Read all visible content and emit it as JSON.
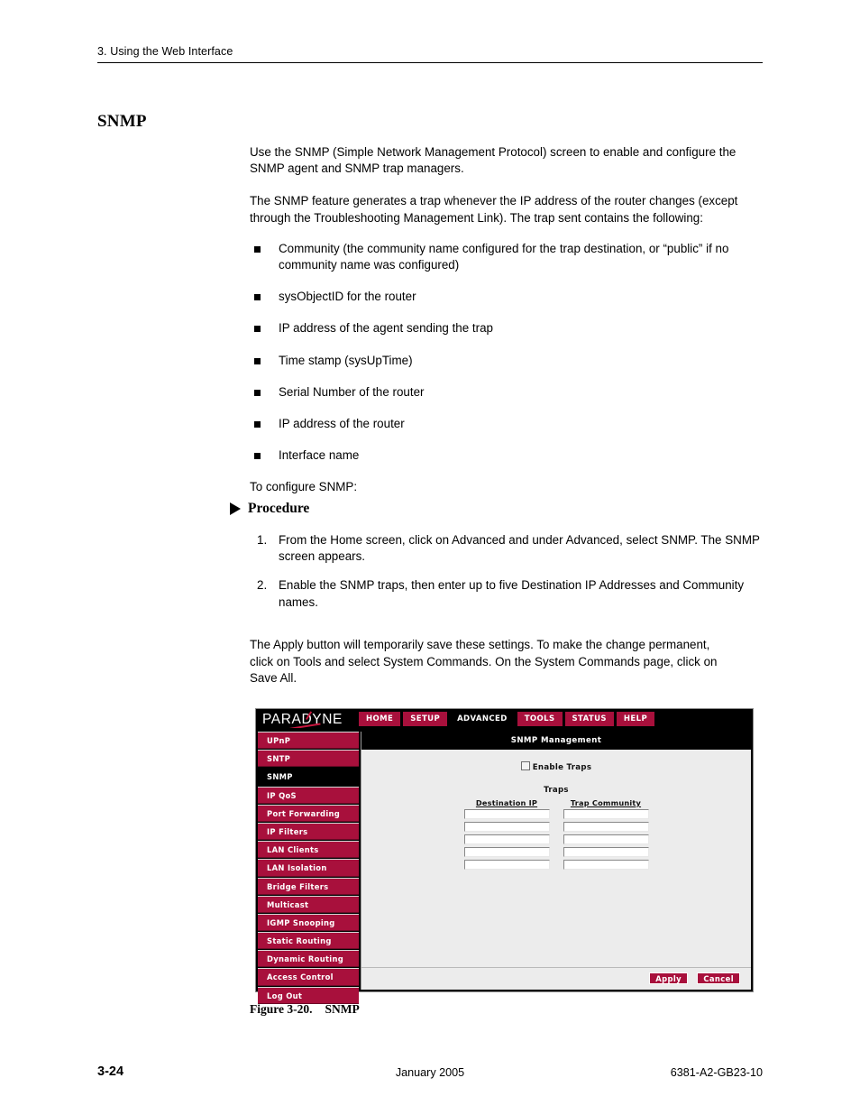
{
  "page": {
    "running_header": "3. Using the Web Interface",
    "section_title": "SNMP",
    "paragraphs": {
      "intro": "Use the SNMP (Simple Network Management Protocol) screen to enable and configure the SNMP agent and SNMP trap managers.",
      "trap_intro": "The SNMP feature generates a trap whenever the IP address of the router changes (except through the Troubleshooting Management Link). The trap sent contains the following:",
      "to_configure": "To configure SNMP:",
      "apply_note": "The Apply button will temporarily save these settings. To make the change permanent, click on Tools and select System Commands. On the System Commands page, click on Save All."
    },
    "bullets": [
      "Community (the community name configured for the trap destination, or “public” if no community name was configured)",
      "sysObjectID for the router",
      "IP address of the agent sending the trap",
      "Time stamp (sysUpTime)",
      "Serial Number of the router",
      "IP address of the router",
      "Interface name"
    ],
    "procedure": {
      "heading": "Procedure",
      "steps": [
        {
          "num": "1.",
          "text": "From the Home screen, click on Advanced and under Advanced, select SNMP. The SNMP screen appears."
        },
        {
          "num": "2.",
          "text": "Enable the SNMP traps, then enter up to five Destination IP Addresses and Community names."
        }
      ]
    },
    "figure_caption": {
      "number": "Figure 3-20.",
      "title": "SNMP"
    },
    "footer": {
      "page_number": "3-24",
      "date": "January 2005",
      "doc_number": "6381-A2-GB23-10"
    }
  },
  "figure": {
    "brand": "PARADYNE",
    "nav_tabs": [
      {
        "label": "HOME",
        "active": false
      },
      {
        "label": "SETUP",
        "active": false
      },
      {
        "label": "ADVANCED",
        "active": true
      },
      {
        "label": "TOOLS",
        "active": false
      },
      {
        "label": "STATUS",
        "active": false
      },
      {
        "label": "HELP",
        "active": false
      }
    ],
    "sidebar": [
      {
        "label": "UPnP",
        "active": false
      },
      {
        "label": "SNTP",
        "active": false
      },
      {
        "label": "SNMP",
        "active": true
      },
      {
        "label": "IP QoS",
        "active": false
      },
      {
        "label": "Port Forwarding",
        "active": false
      },
      {
        "label": "IP Filters",
        "active": false
      },
      {
        "label": "LAN Clients",
        "active": false
      },
      {
        "label": "LAN Isolation",
        "active": false
      },
      {
        "label": "Bridge Filters",
        "active": false
      },
      {
        "label": "Multicast",
        "active": false
      },
      {
        "label": "IGMP Snooping",
        "active": false
      },
      {
        "label": "Static Routing",
        "active": false
      },
      {
        "label": "Dynamic Routing",
        "active": false
      },
      {
        "label": "Access Control",
        "active": false
      },
      {
        "label": "Log Out",
        "active": false
      }
    ],
    "pane_title": "SNMP Management",
    "enable_traps": {
      "label": "Enable Traps",
      "checked": false
    },
    "traps": {
      "title": "Traps",
      "columns": [
        "Destination IP",
        "Trap Community"
      ],
      "rows": [
        {
          "destination_ip": "",
          "trap_community": ""
        },
        {
          "destination_ip": "",
          "trap_community": ""
        },
        {
          "destination_ip": "",
          "trap_community": ""
        },
        {
          "destination_ip": "",
          "trap_community": ""
        },
        {
          "destination_ip": "",
          "trap_community": ""
        }
      ]
    },
    "buttons": {
      "apply": "Apply",
      "cancel": "Cancel"
    },
    "colors": {
      "brand_red": "#a8103c",
      "active_tab": "#000000",
      "pane_bg": "#ececec"
    }
  }
}
